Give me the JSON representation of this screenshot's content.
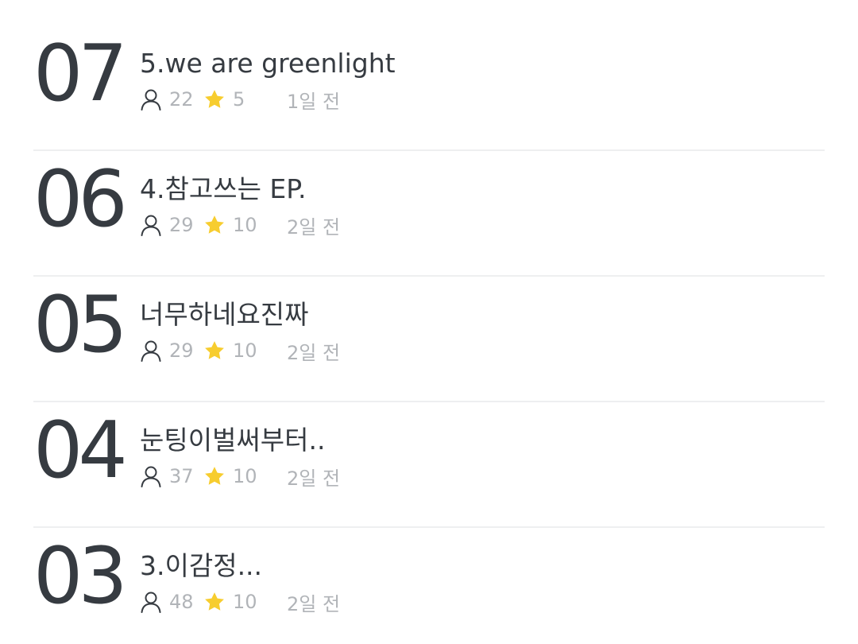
{
  "episodes": [
    {
      "number": "07",
      "title": "5.we are greenlight",
      "views": "22",
      "stars": "5",
      "date": "1일 전"
    },
    {
      "number": "06",
      "title": "4.참고쓰는 EP.",
      "views": "29",
      "stars": "10",
      "date": "2일 전"
    },
    {
      "number": "05",
      "title": "너무하네요진짜",
      "views": "29",
      "stars": "10",
      "date": "2일 전"
    },
    {
      "number": "04",
      "title": "눈팅이벌써부터..",
      "views": "37",
      "stars": "10",
      "date": "2일 전"
    },
    {
      "number": "03",
      "title": "3.이감정...",
      "views": "48",
      "stars": "10",
      "date": "2일 전"
    }
  ],
  "colors": {
    "text": "#363b41",
    "meta": "#b1b4b8",
    "star": "#f7cd2f",
    "divider": "#eeeff0"
  },
  "icons": {
    "views": "person-icon",
    "rating": "star-icon"
  }
}
